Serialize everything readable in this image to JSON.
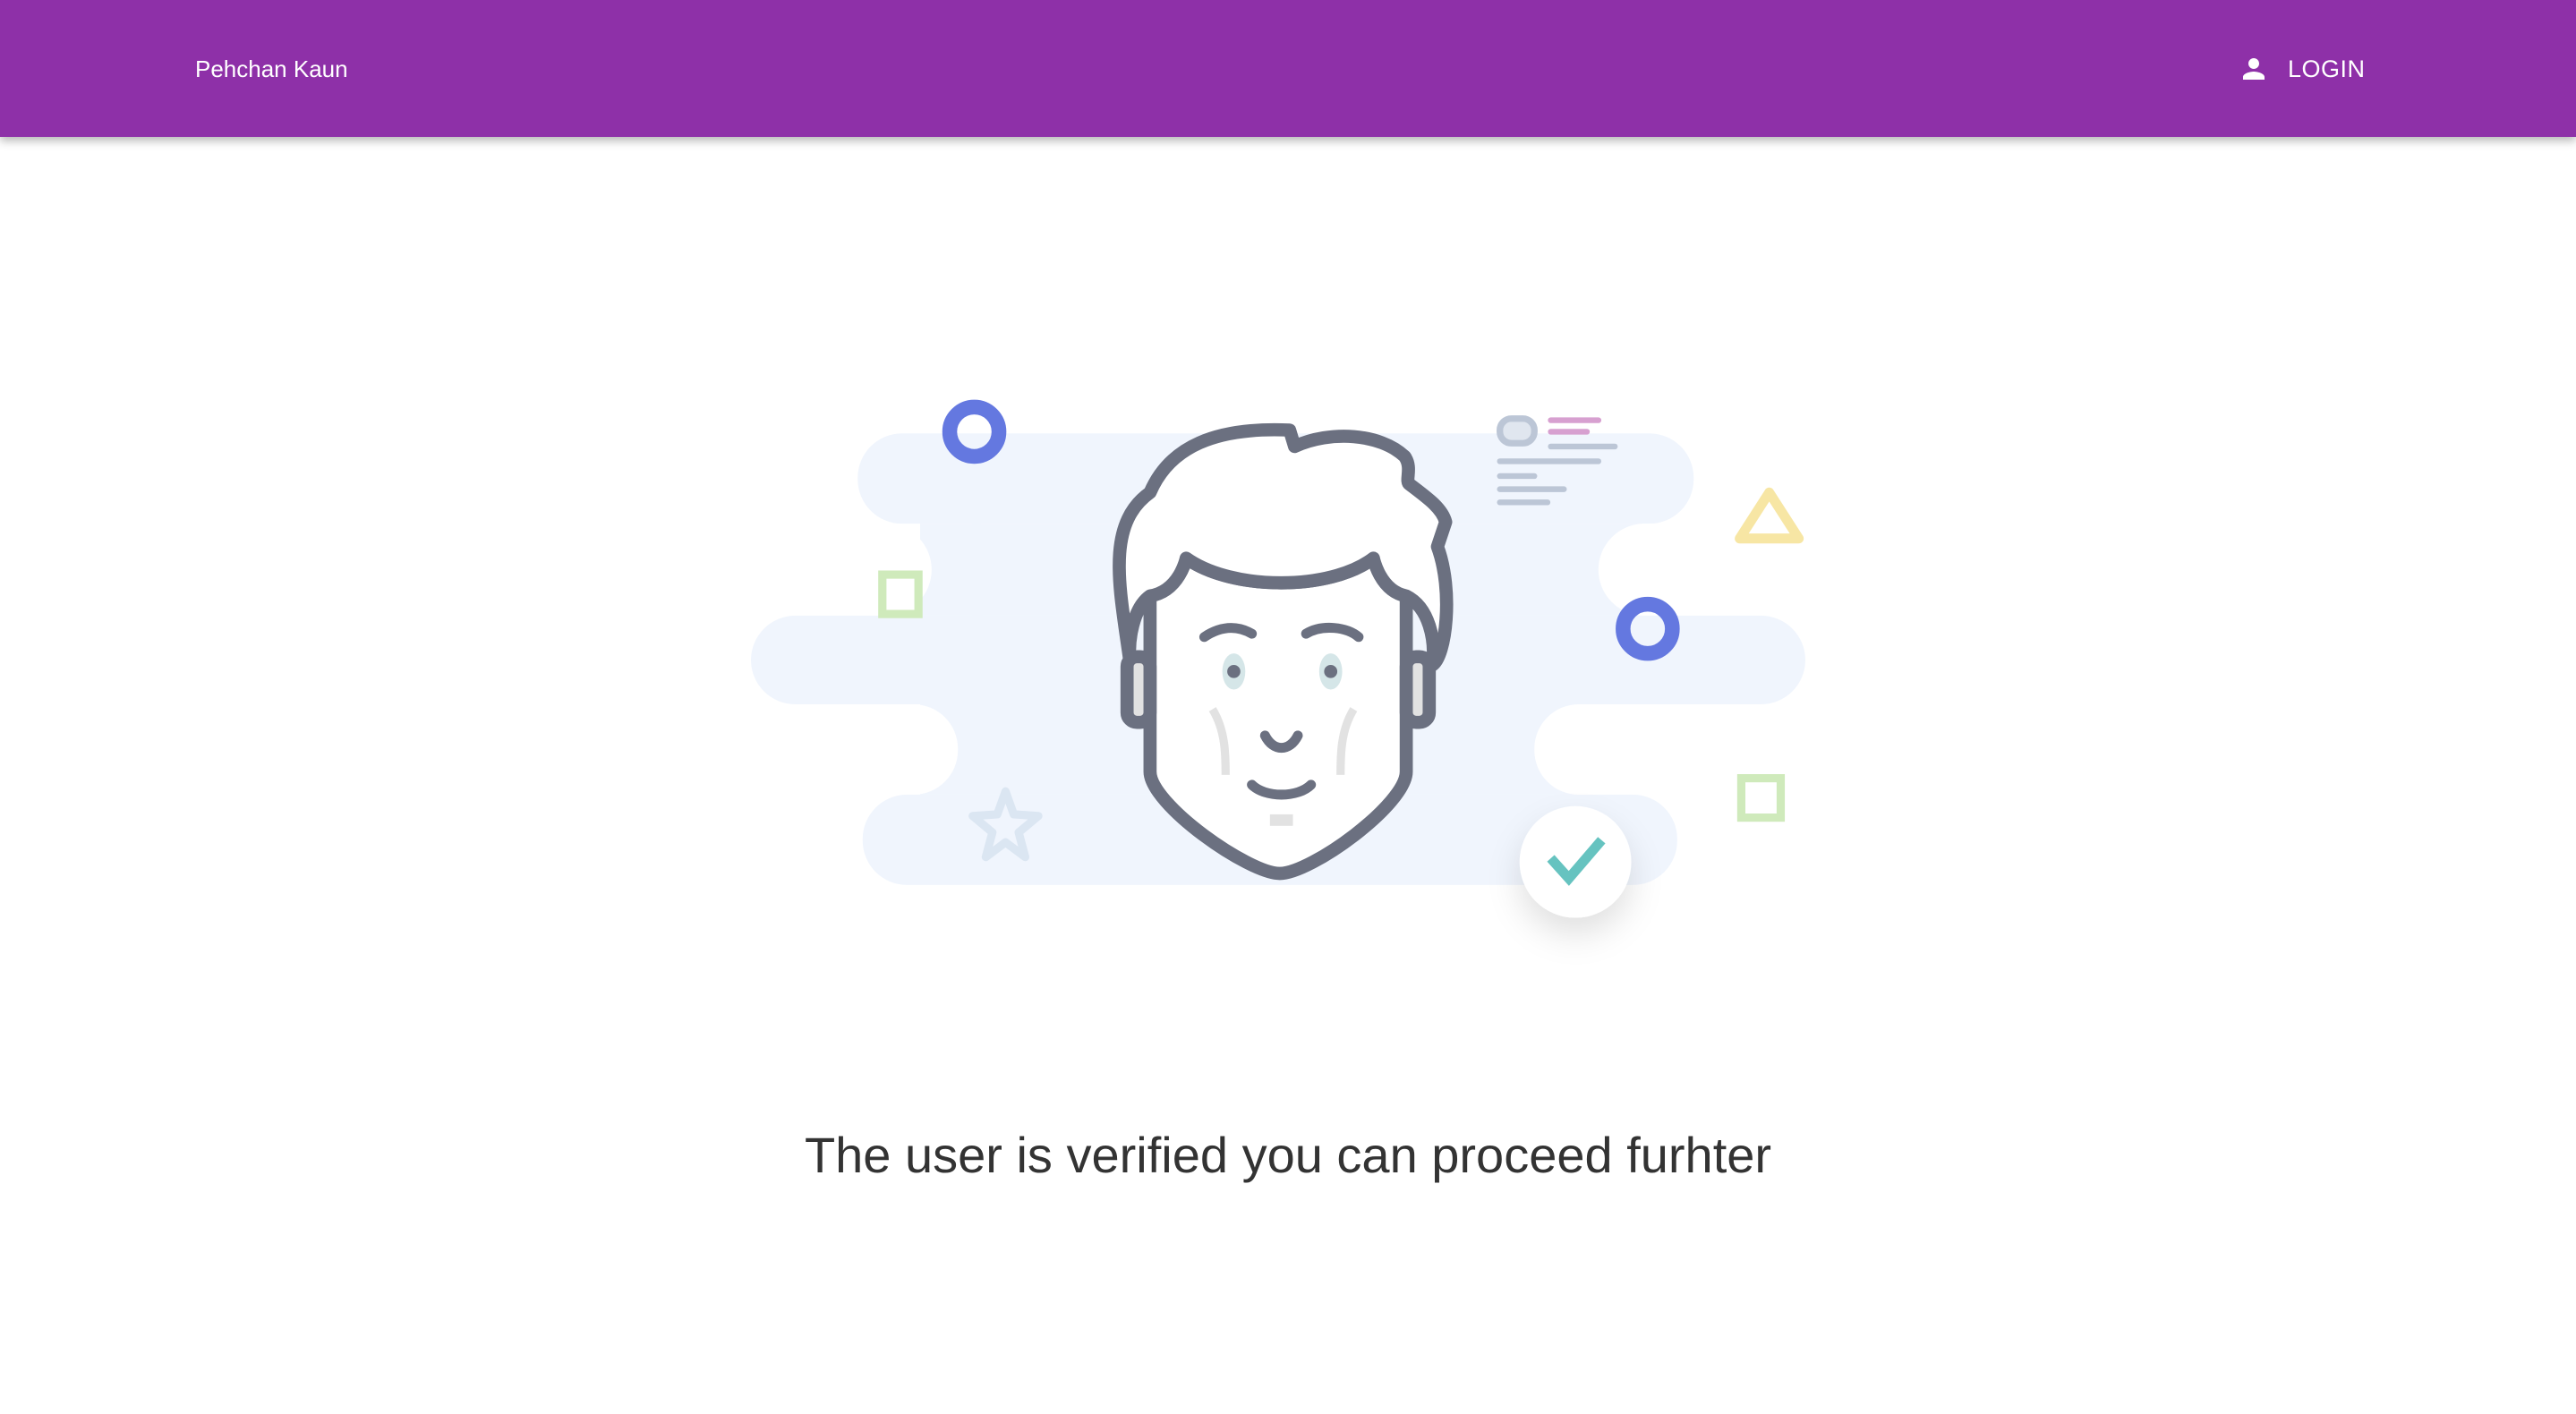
{
  "appbar": {
    "title": "Pehchan Kaun",
    "login_label": "LOGIN",
    "login_icon": "person-icon",
    "color": "#8e30a8"
  },
  "main": {
    "illustration_icon": "face-verified-illustration",
    "message": "The user is verified you can proceed furhter"
  }
}
